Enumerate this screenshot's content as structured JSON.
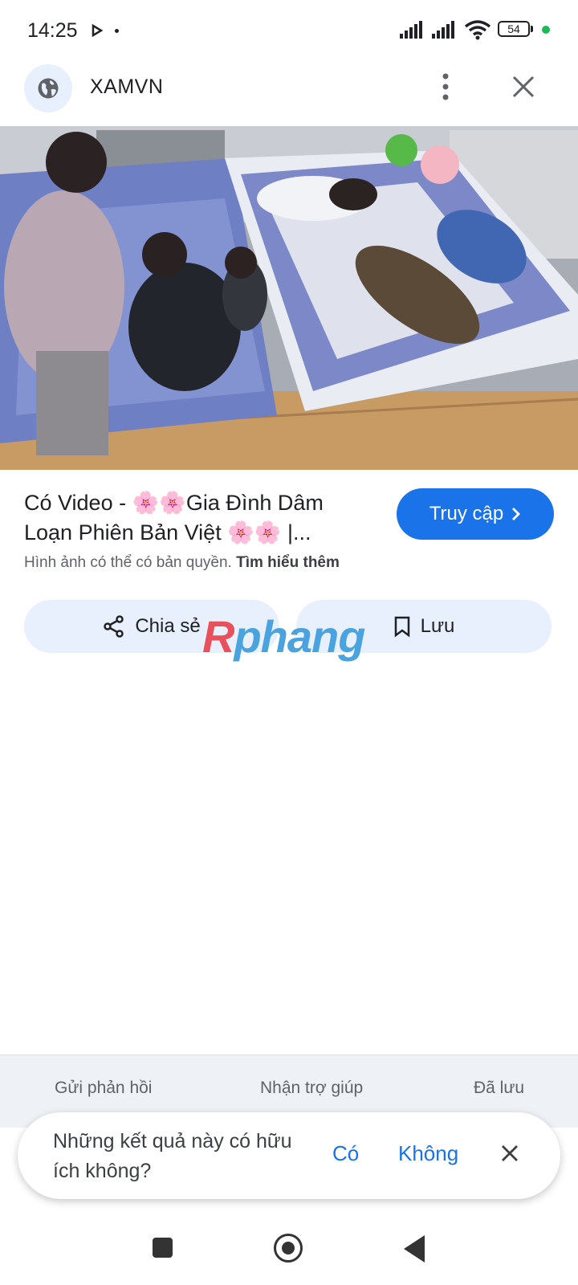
{
  "status_bar": {
    "time": "14:25",
    "battery": "54",
    "icons": [
      "play-icon",
      "signal-icon",
      "signal-icon",
      "wifi-icon",
      "battery-icon"
    ]
  },
  "header": {
    "site_name": "XAMVN",
    "icons": [
      "globe-icon",
      "more-vertical-icon",
      "close-icon"
    ]
  },
  "result": {
    "title": "Có Video - 🌸🌸Gia Đình Dâm Loạn Phiên Bản Việt 🌸🌸 |...",
    "copyright_notice": "Hình ảnh có thể có bản quyền.",
    "learn_more": "Tìm hiểu thêm",
    "visit_label": "Truy cập"
  },
  "actions": {
    "share_label": "Chia sẻ",
    "save_label": "Lưu"
  },
  "watermark": {
    "first_letter": "R",
    "rest": "phang"
  },
  "footer": {
    "send_feedback": "Gửi phản hồi",
    "get_help": "Nhận trợ giúp",
    "saved": "Đã lưu"
  },
  "feedback_prompt": {
    "question": "Những kết quả này có hữu ích không?",
    "yes": "Có",
    "no": "Không"
  },
  "colors": {
    "accent": "#1a73e8",
    "chip_background": "#e8f0fe",
    "footer_background": "#eef1f5"
  }
}
